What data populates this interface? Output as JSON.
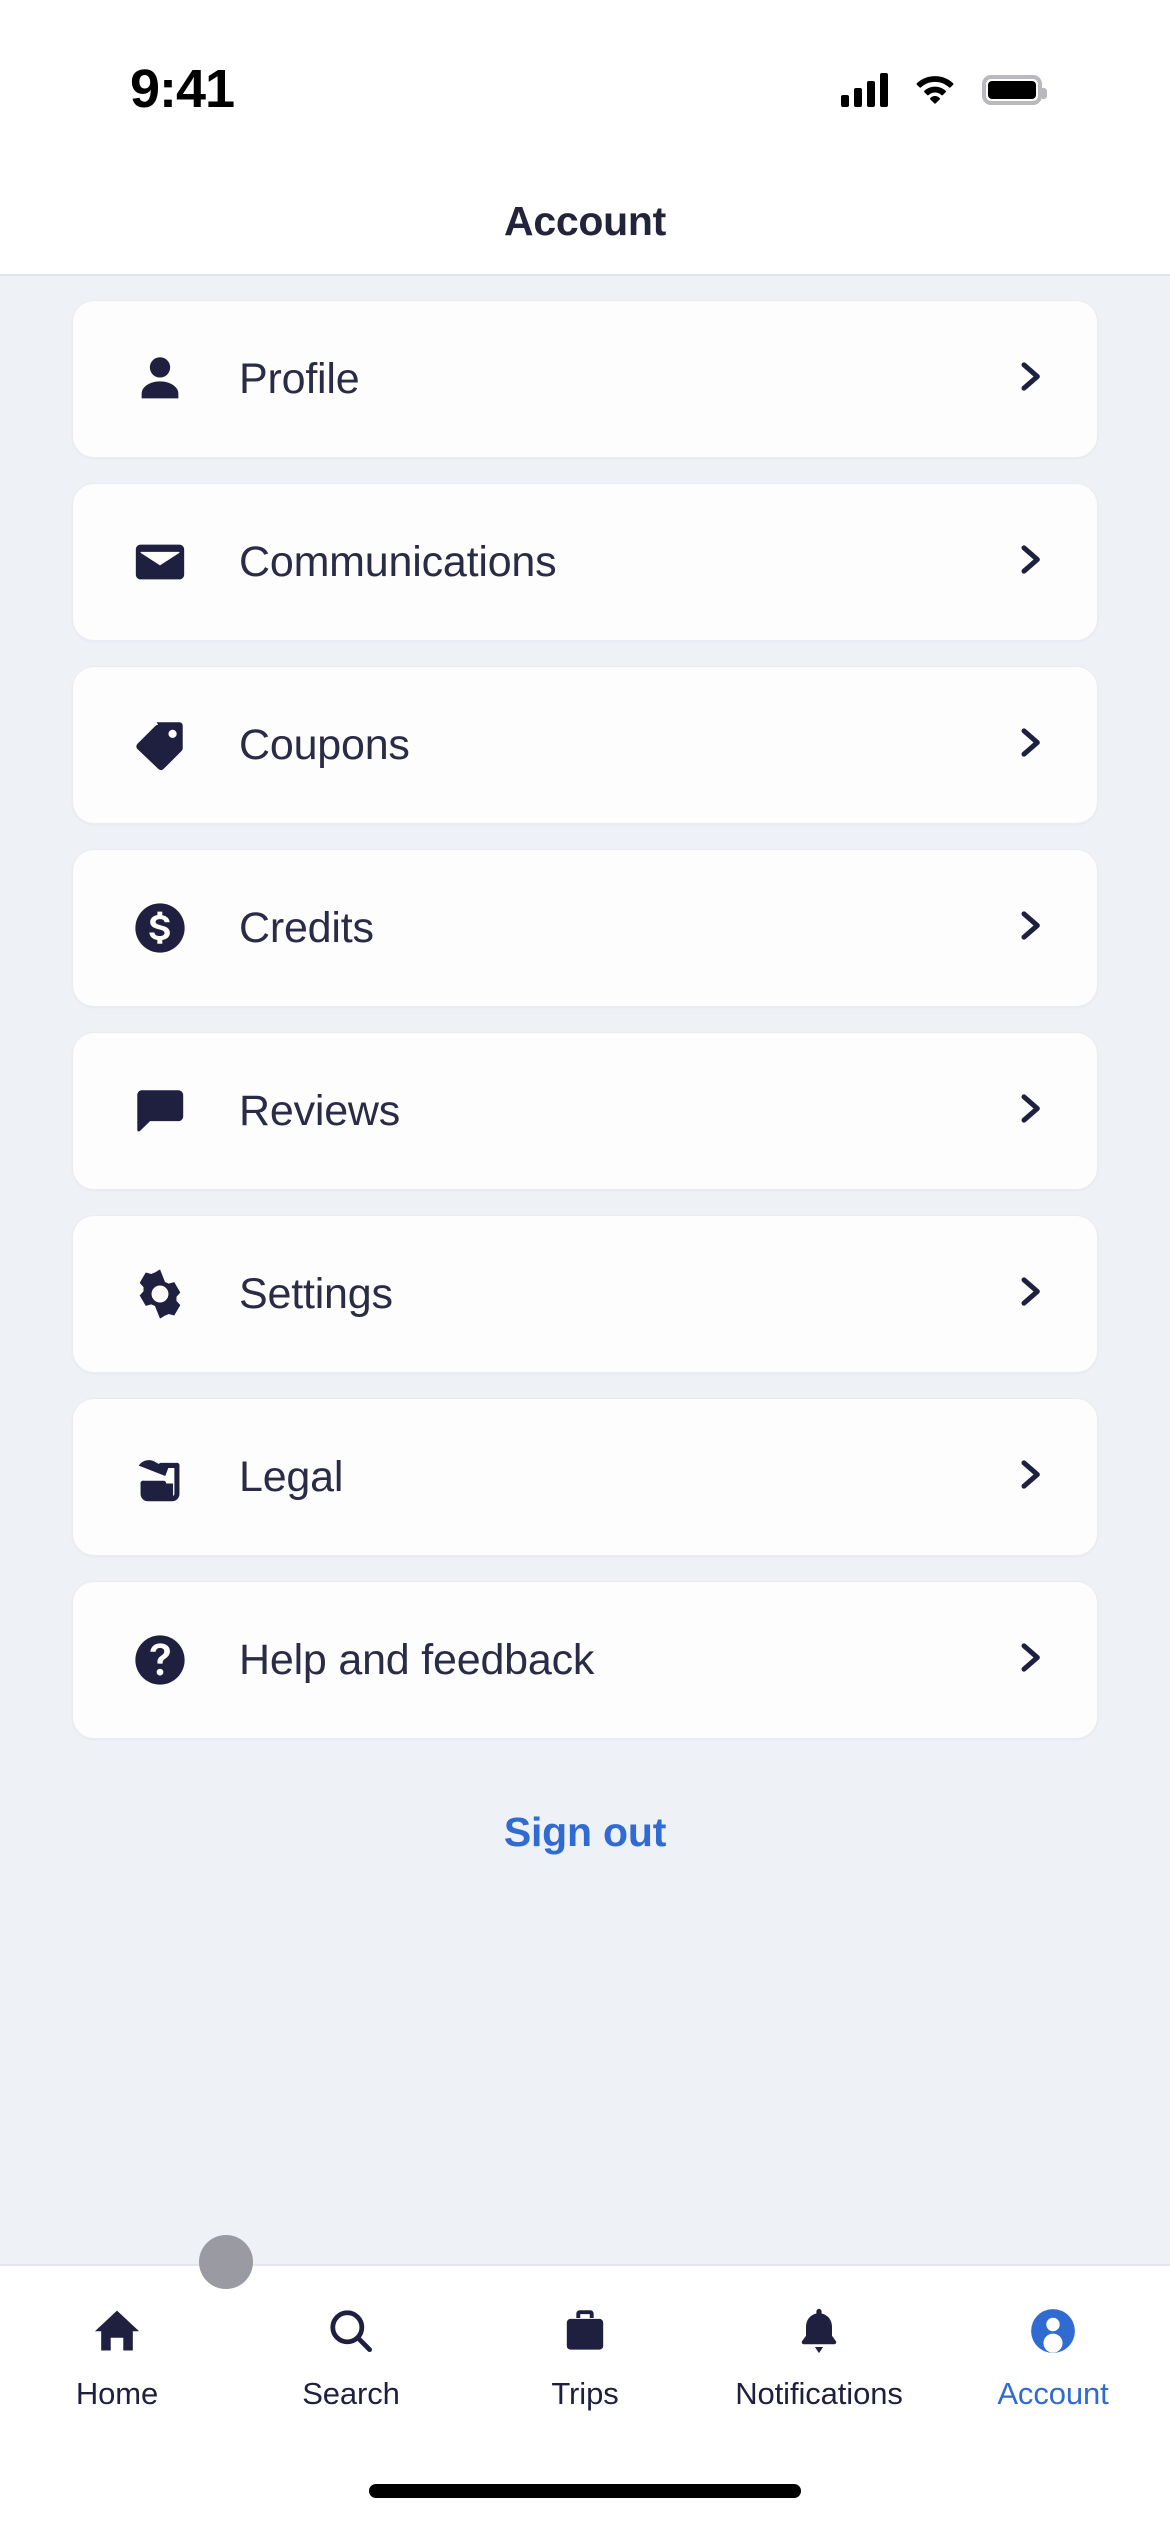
{
  "status_bar": {
    "time": "9:41",
    "cellular_icon": "signal-bars-icon",
    "wifi_icon": "wifi-icon",
    "battery_icon": "battery-full-icon"
  },
  "header": {
    "title": "Account"
  },
  "menu": {
    "items": [
      {
        "label": "Profile",
        "icon": "person-icon"
      },
      {
        "label": "Communications",
        "icon": "envelope-icon"
      },
      {
        "label": "Coupons",
        "icon": "tag-icon"
      },
      {
        "label": "Credits",
        "icon": "dollar-coin-icon"
      },
      {
        "label": "Reviews",
        "icon": "speech-bubble-icon"
      },
      {
        "label": "Settings",
        "icon": "gear-icon"
      },
      {
        "label": "Legal",
        "icon": "document-quill-icon"
      },
      {
        "label": "Help and feedback",
        "icon": "question-circle-icon"
      }
    ],
    "chevron_icon": "chevron-right-icon"
  },
  "sign_out": {
    "label": "Sign out"
  },
  "tab_bar": {
    "tabs": [
      {
        "label": "Home",
        "icon": "home-icon",
        "active": false
      },
      {
        "label": "Search",
        "icon": "search-icon",
        "active": false
      },
      {
        "label": "Trips",
        "icon": "suitcase-icon",
        "active": false
      },
      {
        "label": "Notifications",
        "icon": "bell-icon",
        "active": false
      },
      {
        "label": "Account",
        "icon": "person-circle-icon",
        "active": true
      }
    ]
  },
  "colors": {
    "background": "#eef1f6",
    "card": "#fdfdfe",
    "text_dark": "#2a2b46",
    "accent_blue": "#2f6bd1",
    "icon_dark": "#1f2040"
  }
}
